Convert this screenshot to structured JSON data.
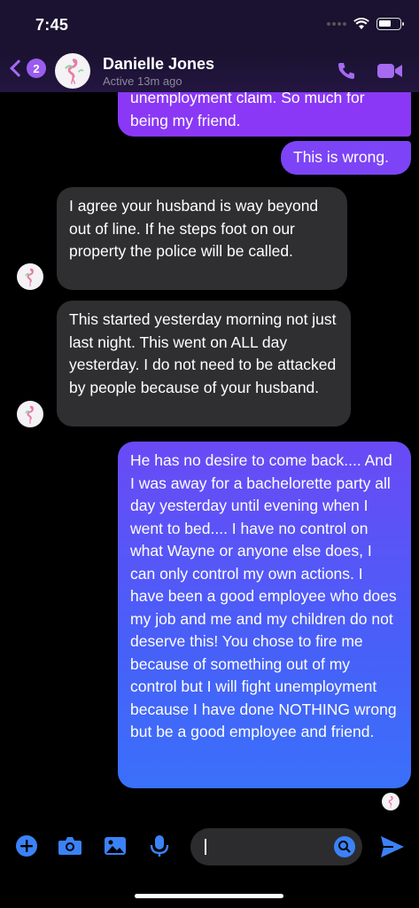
{
  "status_bar": {
    "time": "7:45"
  },
  "header": {
    "unread_count": "2",
    "contact_name": "Danielle Jones",
    "contact_status": "Active 13m ago"
  },
  "messages": [
    {
      "direction": "outgoing",
      "text": "unemployment claim. So much for being my friend."
    },
    {
      "direction": "outgoing",
      "text": "This is wrong."
    },
    {
      "direction": "incoming",
      "text": "I agree your husband is way beyond out of line. If he steps foot on our property the police will be called."
    },
    {
      "direction": "incoming",
      "text": "This started yesterday morning not just last night. This went on ALL day yesterday. I do not need to be attacked by people because of your husband."
    },
    {
      "direction": "outgoing",
      "text": "He has no desire to come back.... And I was away for a bachelorette party all day yesterday until evening when I went to bed.... I have no control on what Wayne or anyone else does, I can only control my own actions. I have been a good employee who does my job and me and my children do not deserve this! You chose to fire me because of something out of my control but I will fight unemployment because I have done NOTHING wrong but be a good employee and friend."
    }
  ],
  "composer": {
    "input_value": ""
  },
  "colors": {
    "accent": "#9b5cf0",
    "incoming_bubble": "#2f2f31",
    "send": "#3b82f6"
  },
  "icons": [
    "back-chevron-icon",
    "phone-icon",
    "video-call-icon",
    "plus-icon",
    "camera-icon",
    "image-icon",
    "microphone-icon",
    "emoji-icon",
    "send-icon"
  ]
}
